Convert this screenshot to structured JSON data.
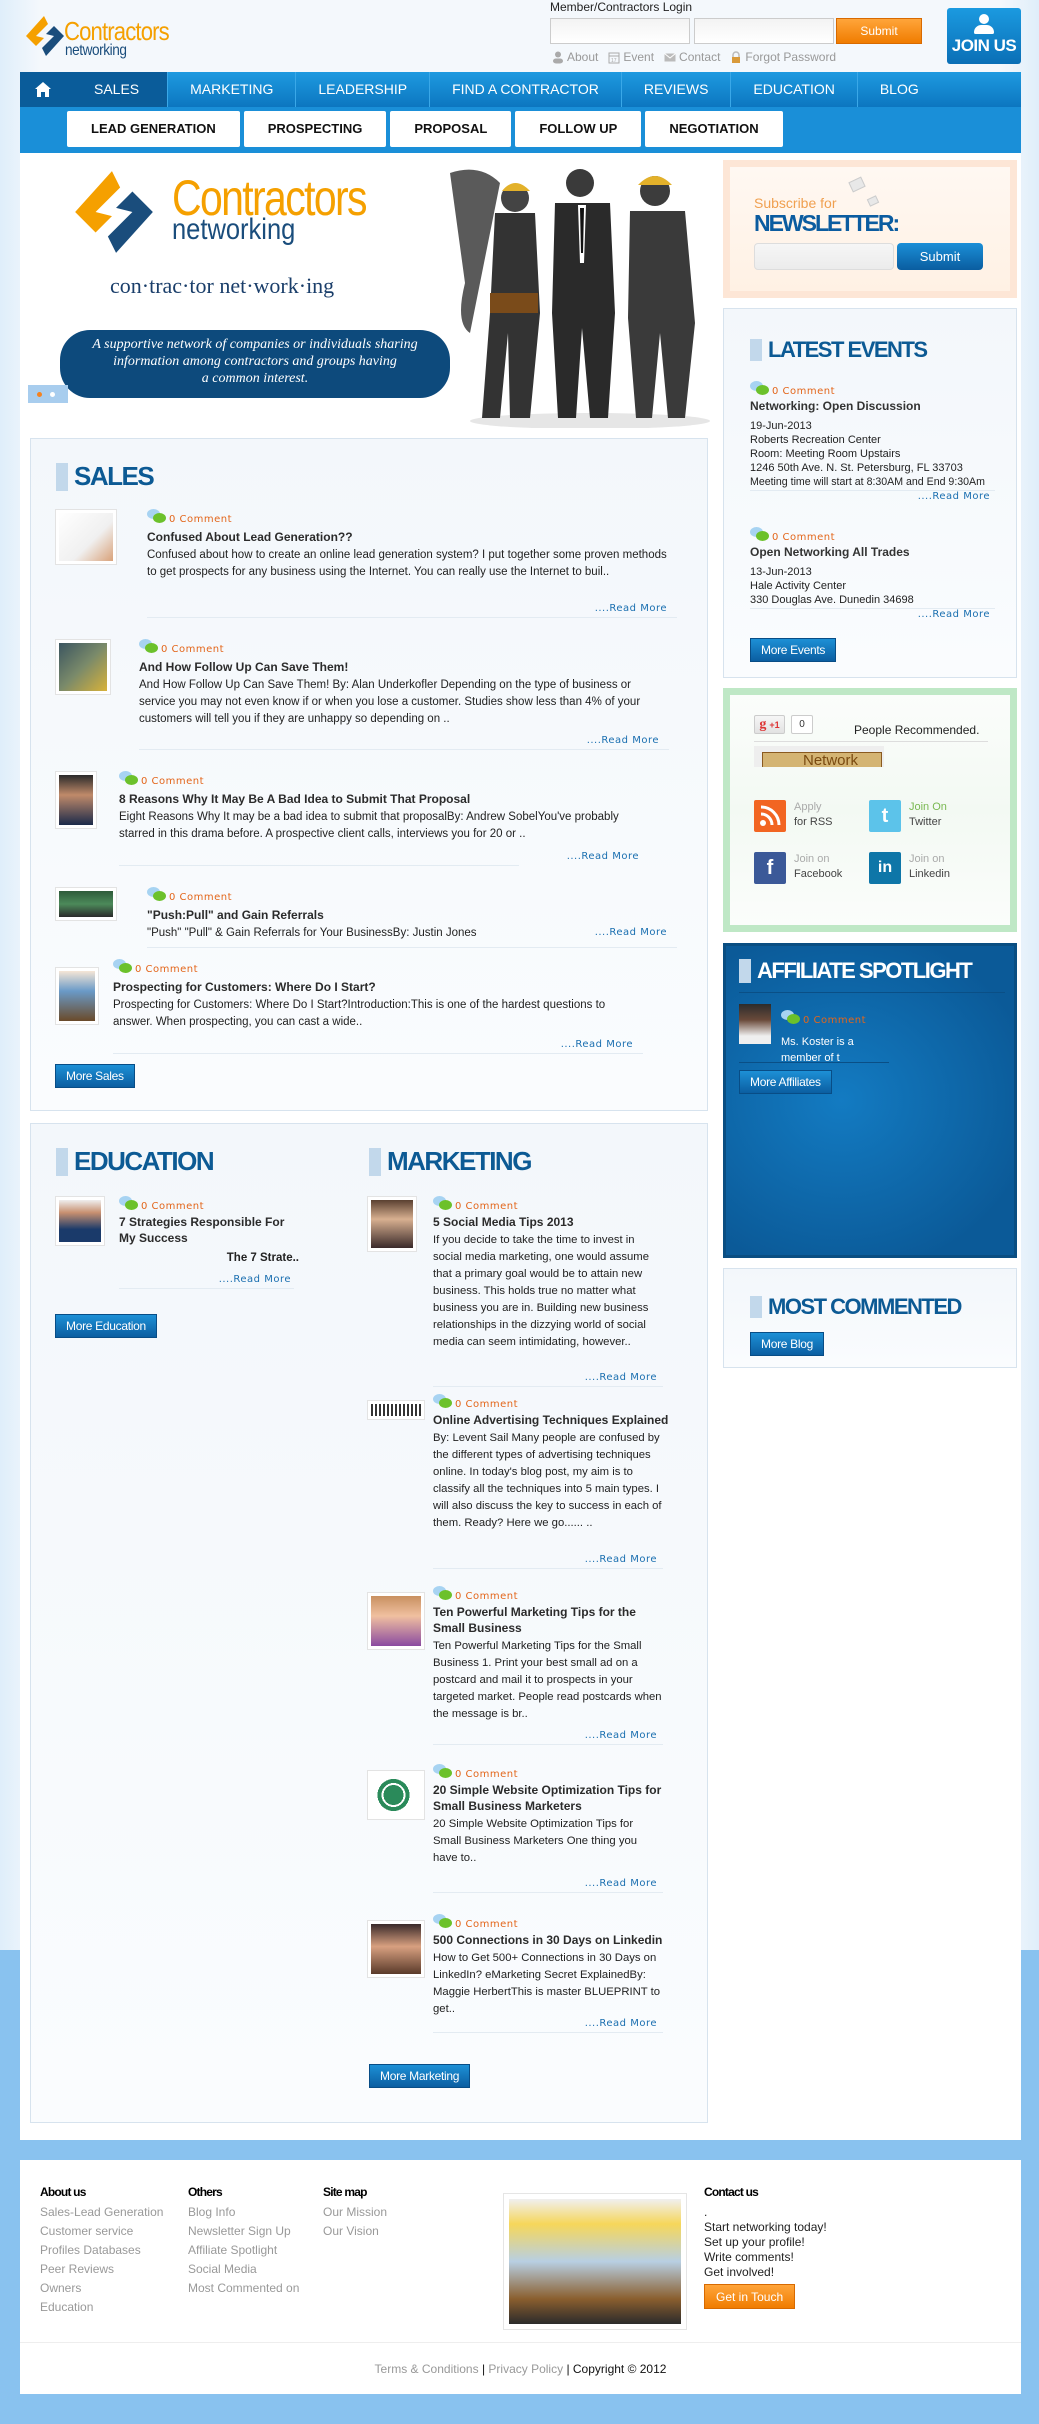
{
  "header": {
    "logo": {
      "line1": "Contractors",
      "line2": "networking"
    },
    "login": {
      "label": "Member/Contractors Login",
      "username_value": "",
      "password_value": "",
      "submit": "Submit"
    },
    "quick_links": [
      {
        "icon": "person-icon",
        "label": "About"
      },
      {
        "icon": "calendar-icon",
        "label": "Event"
      },
      {
        "icon": "envelope-icon",
        "label": "Contact"
      },
      {
        "icon": "lock-icon",
        "label": "Forgot Password"
      }
    ],
    "join": "JOIN US"
  },
  "nav": {
    "home_icon": "home-icon",
    "items": [
      "SALES",
      "MARKETING",
      "LEADERSHIP",
      "FIND A CONTRACTOR",
      "REVIEWS",
      "EDUCATION",
      "BLOG"
    ],
    "active": "SALES",
    "sub_items": [
      "LEAD GENERATION",
      "PROSPECTING",
      "PROPOSAL",
      "FOLLOW UP",
      "NEGOTIATION"
    ]
  },
  "hero": {
    "logo_line1": "Contractors",
    "logo_line2": "networking",
    "definition": "con·trac·tor   net·work·ing",
    "tagline_1": "A supportive network of companies or individuals sharing",
    "tagline_2": "information among contractors and groups having",
    "tagline_3": "a common interest.",
    "slides": 2,
    "active_slide": 1
  },
  "sales": {
    "title": "SALES",
    "posts": [
      {
        "comments": "0 Comment",
        "title": "Confused About Lead Generation??",
        "excerpt": "Confused about how to create an online lead generation system? I put together some proven methods to get prospects for any business using the Internet. You can really use the Internet to buil..",
        "readmore": "....Read More"
      },
      {
        "comments": "0 Comment",
        "title": "And How Follow Up Can Save Them!",
        "excerpt": "And How Follow Up Can Save Them! By: Alan Underkofler Depending on the type of business or service you may not even know if or when you lose a customer. Studies show less than 4% of your customers will tell you if they are unhappy so depending on ..",
        "readmore": "....Read More"
      },
      {
        "comments": "0 Comment",
        "title": "8 Reasons Why It May Be A Bad Idea to Submit That Proposal",
        "excerpt": "Eight Reasons Why It may be a bad idea to submit that proposalBy: Andrew SobelYou've probably starred in this drama before. A prospective client calls, interviews you for 20 or ..",
        "readmore": "....Read More"
      },
      {
        "comments": "0 Comment",
        "title": "\"Push:Pull\" and Gain Referrals",
        "excerpt": "\"Push\" \"Pull\" & Gain Referrals for Your BusinessBy: Justin Jones",
        "readmore": "....Read More"
      },
      {
        "comments": "0 Comment",
        "title": "Prospecting for Customers: Where Do I Start?",
        "excerpt": "Prospecting for Customers:  Where Do I Start?Introduction:This is one of the hardest questions to answer.  When prospecting, you can cast a wide..",
        "readmore": "....Read More"
      }
    ],
    "more": "More Sales"
  },
  "education": {
    "title": "EDUCATION",
    "posts": [
      {
        "comments": "0 Comment",
        "title": "7 Strategies Responsible For My Success",
        "excerpt": "The 7 Strate..",
        "readmore": "....Read More"
      }
    ],
    "more": "More Education"
  },
  "marketing": {
    "title": "MARKETING",
    "posts": [
      {
        "comments": "0 Comment",
        "title": "5 Social Media Tips 2013",
        "excerpt": "If you decide to take the time to invest in social media marketing, one would assume that a primary goal would be to attain new business. This holds true no matter what business you are in. Building new business relationships in the dizzying world of social media can seem intimidating, however..",
        "readmore": "....Read More"
      },
      {
        "comments": "0 Comment",
        "title": "Online Advertising Techniques Explained",
        "excerpt": "By: Levent Sail Many people are confused by the different types of advertising techniques online. In today's blog post, my aim is to classify all the techniques into 5 main types. I will also discuss the key to success in each of them. Ready? Here we go...... ..",
        "readmore": "....Read More"
      },
      {
        "comments": "0 Comment",
        "title": "Ten Powerful Marketing Tips for the Small Business",
        "excerpt": "Ten Powerful Marketing Tips for the Small Business 1. Print your best small ad on a postcard and mail it to prospects in your targeted market. People read postcards when the message is br..",
        "readmore": "....Read More"
      },
      {
        "comments": "0 Comment",
        "title": "20 Simple Website Optimization Tips for Small Business Marketers",
        "excerpt": "20 Simple Website Optimization Tips for Small Business Marketers One thing you have to..",
        "readmore": "....Read More"
      },
      {
        "comments": "0 Comment",
        "title": "500 Connections in 30 Days on Linkedin",
        "excerpt": "How to Get 500+ Connections in 30 Days on LinkedIn? eMarketing Secret ExplainedBy: Maggie HerbertThis is master BLUEPRINT to get..",
        "readmore": "....Read More"
      }
    ],
    "more": "More Marketing"
  },
  "sidebar": {
    "newsletter": {
      "line1": "Subscribe for",
      "line2": "NEWSLETTER:",
      "email_value": "",
      "submit": "Submit"
    },
    "events": {
      "title": "LATEST EVENTS",
      "items": [
        {
          "comments": "0 Comment",
          "title": "Networking: Open Discussion",
          "lines": [
            "19-Jun-2013",
            "Roberts Recreation Center",
            "Room: Meeting Room Upstairs",
            "1246 50th Ave. N. St. Petersburg, FL 33703",
            "Meeting time will start at 8:30AM and End 9:30Am"
          ],
          "readmore": "....Read More"
        },
        {
          "comments": "0 Comment",
          "title": "Open Networking All Trades",
          "lines": [
            "13-Jun-2013",
            "Hale Activity Center",
            "330 Douglas Ave. Dunedin 34698"
          ],
          "readmore": "....Read More"
        }
      ],
      "more": "More Events"
    },
    "social": {
      "gplus_label": "+1",
      "gplus_count": "0",
      "recommended": "People Recommended.",
      "network_tag": "Network",
      "links": [
        {
          "icon": "rss-icon",
          "line1": "Apply",
          "line2": "for RSS",
          "color": "#f26522"
        },
        {
          "icon": "twitter-icon",
          "line1": "Join On",
          "line2": "Twitter",
          "color": "#5cc3ea"
        },
        {
          "icon": "facebook-icon",
          "line1": "Join on",
          "line2": "Facebook",
          "color": "#3b5998"
        },
        {
          "icon": "linkedin-icon",
          "line1": "Join on",
          "line2": "Linkedin",
          "color": "#0e76a8"
        }
      ]
    },
    "affiliate": {
      "title": "AFFILIATE SPOTLIGHT",
      "comments": "0 Comment",
      "desc_1": "Ms. Koster is a",
      "desc_2": "member of t",
      "more": "More Affiliates"
    },
    "most_commented": {
      "title": "MOST COMMENTED",
      "more": "More Blog"
    }
  },
  "footer": {
    "about": {
      "heading": "About us",
      "links": [
        "Sales-Lead Generation",
        "Customer service",
        "Profiles Databases",
        "Peer Reviews",
        "Owners",
        "Education"
      ]
    },
    "others": {
      "heading": "Others",
      "links": [
        "Blog Info",
        "Newsletter Sign Up",
        "Affiliate Spotlight",
        "Social Media",
        "Most Commented on"
      ]
    },
    "sitemap": {
      "heading": "Site map",
      "links": [
        "Our Mission",
        "Our Vision"
      ]
    },
    "contact": {
      "heading": "Contact us",
      "lines": [
        ".",
        "Start networking today!",
        "Set up your profile!",
        "Write comments!",
        "Get involved!"
      ],
      "button": "Get in Touch"
    },
    "terms": "Terms & Conditions",
    "privacy": "Privacy Policy",
    "copyright": "| Copyright © 2012",
    "sep": "|"
  },
  "colors": {
    "brand_blue": "#0c5a94",
    "brand_orange": "#f5a000",
    "accent_orange": "#f07c00",
    "comment_orange": "#e3661b"
  }
}
